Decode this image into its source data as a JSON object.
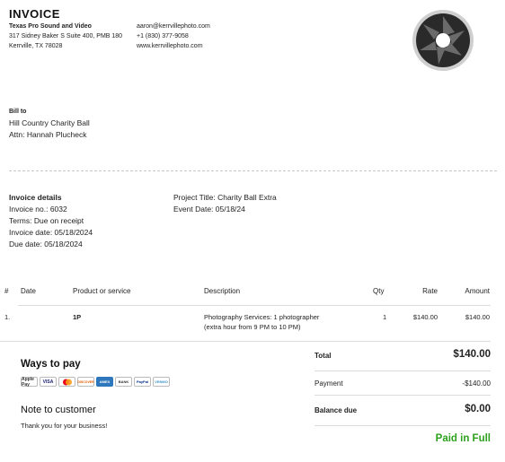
{
  "invoice_title": "INVOICE",
  "company": {
    "name": "Texas Pro Sound and Video",
    "address_line1": "317 Sidney Baker S Suite 400, PMB 180",
    "address_line2": "Kerrville, TX 78028",
    "email": "aaron@kerrvillephoto.com",
    "phone": "+1 (830) 377-9058",
    "website": "www.kerrvillephoto.com"
  },
  "logo_icon": "camera-aperture-icon",
  "bill_to": {
    "label": "Bill to",
    "name": "Hill Country Charity Ball",
    "attn": "Attn: Hannah Plucheck"
  },
  "details": {
    "label": "Invoice details",
    "invoice_no": "Invoice no.: 6032",
    "terms": "Terms: Due on receipt",
    "invoice_date": "Invoice date: 05/18/2024",
    "due_date": "Due date: 05/18/2024",
    "project_title": "Project Title: Charity Ball Extra",
    "event_date": "Event Date: 05/18/24"
  },
  "table": {
    "headers": {
      "num": "#",
      "date": "Date",
      "product": "Product or service",
      "description": "Description",
      "qty": "Qty",
      "rate": "Rate",
      "amount": "Amount"
    },
    "rows": [
      {
        "num": "1.",
        "date": "",
        "product": "1P",
        "description_line1": "Photography Services: 1 photographer",
        "description_line2": "(extra hour from 9 PM to 10 PM)",
        "qty": "1",
        "rate": "$140.00",
        "amount": "$140.00"
      }
    ]
  },
  "ways_to_pay": {
    "title": "Ways to pay",
    "methods": [
      "Apple Pay",
      "VISA",
      "Mastercard",
      "DISCOVER",
      "AMEX",
      "BANK",
      "PayPal",
      "VENMO"
    ]
  },
  "note": {
    "title": "Note to customer",
    "text": "Thank you for your business!"
  },
  "summary": {
    "total_label": "Total",
    "total_value": "$140.00",
    "payment_label": "Payment",
    "payment_value": "-$140.00",
    "balance_label": "Balance due",
    "balance_value": "$0.00",
    "status": "Paid in Full"
  },
  "colors": {
    "paid": "#2ca01c",
    "divider": "#dddddd"
  }
}
